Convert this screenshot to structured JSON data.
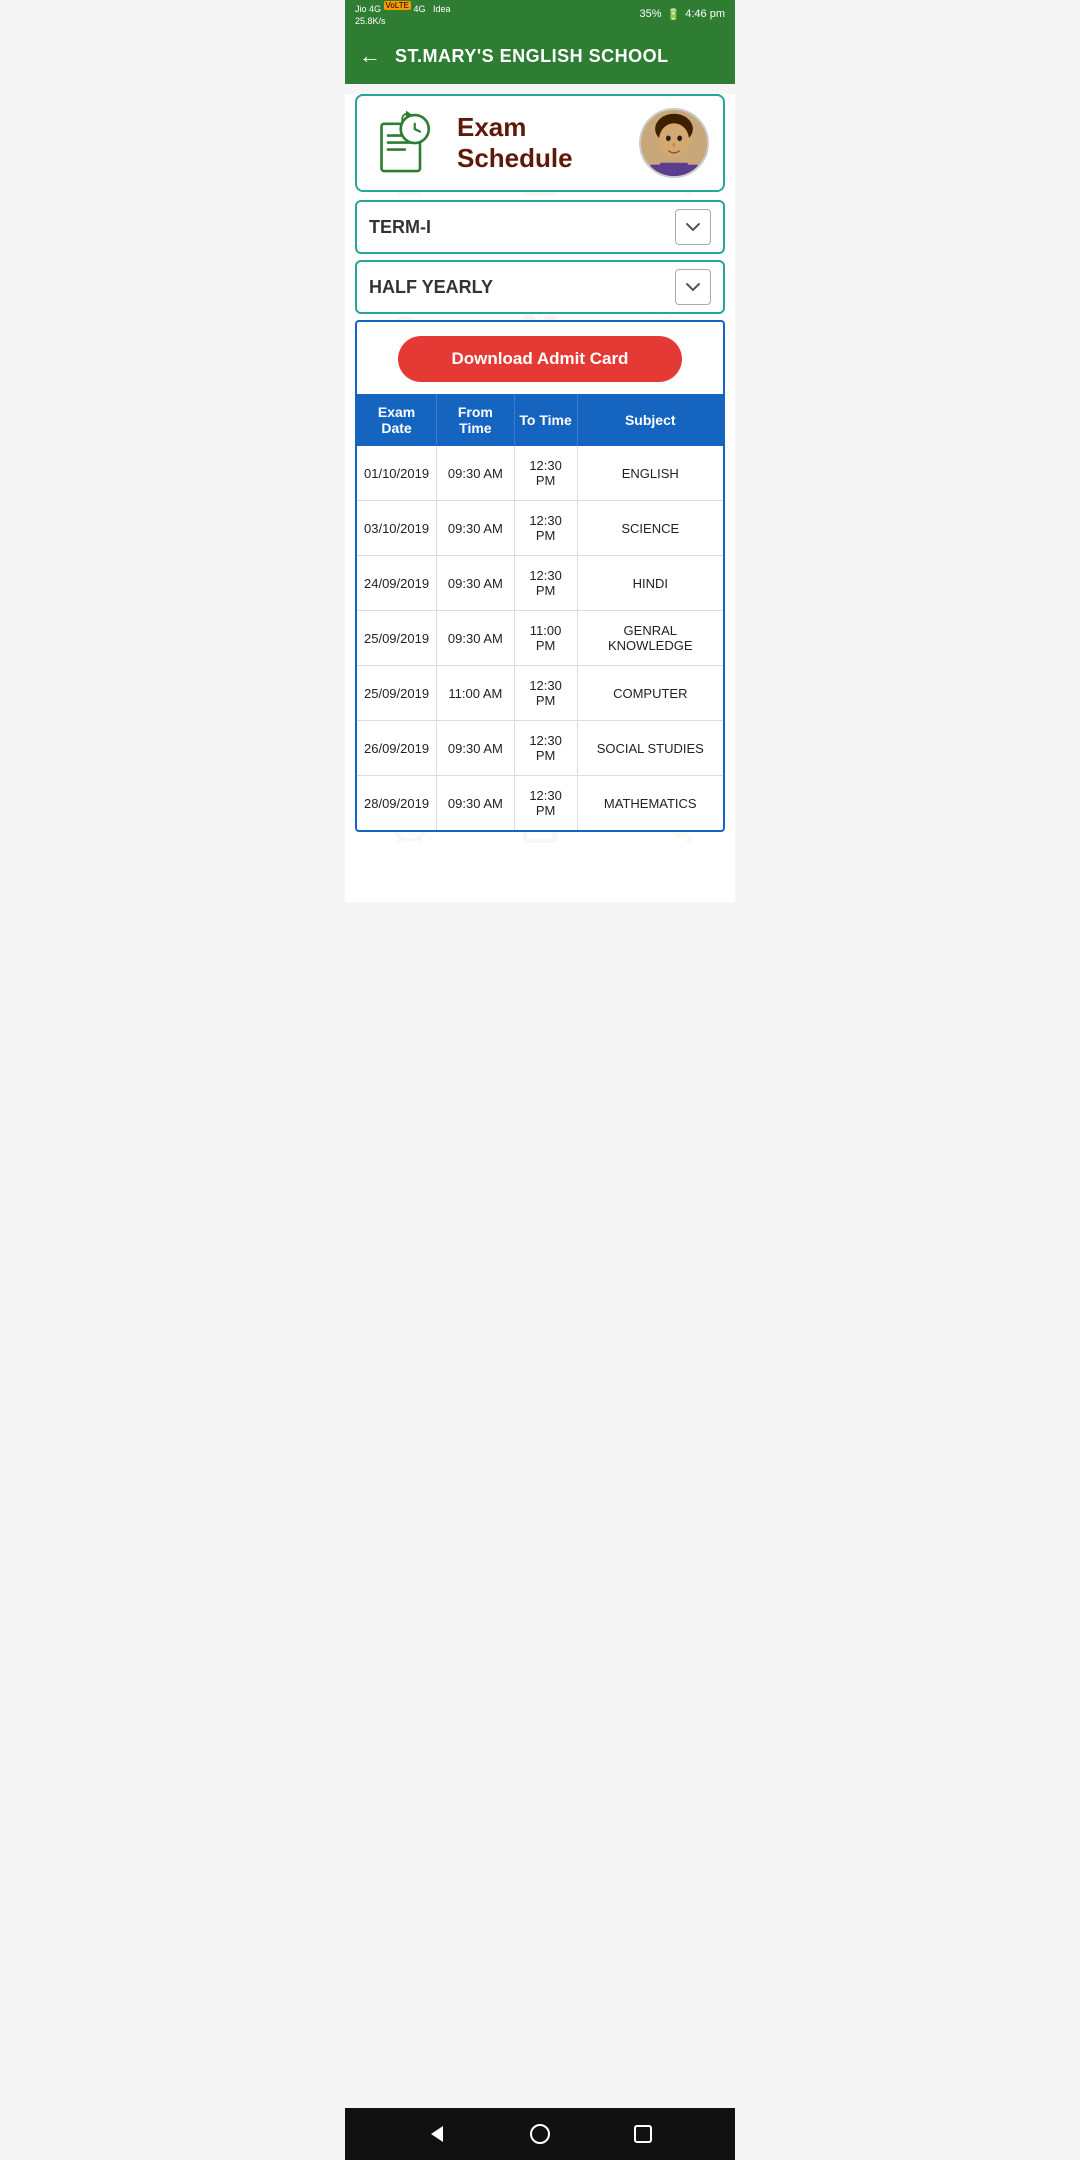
{
  "statusBar": {
    "carrier1": "Jio 4G",
    "carrier2": "Idea",
    "signal": "25.8K/s",
    "battery": "35%",
    "time": "4:46 pm"
  },
  "header": {
    "title": "ST.MARY'S ENGLISH SCHOOL",
    "backLabel": "←"
  },
  "examSchedule": {
    "title": "Exam Schedule",
    "iconAlt": "exam-schedule-icon"
  },
  "dropdowns": {
    "term": "TERM-I",
    "period": "HALF YEARLY"
  },
  "downloadButton": "Download Admit Card",
  "table": {
    "headers": [
      "Exam Date",
      "From Time",
      "To Time",
      "Subject"
    ],
    "rows": [
      {
        "date": "01/10/2019",
        "from": "09:30 AM",
        "to": "12:30 PM",
        "subject": "ENGLISH"
      },
      {
        "date": "03/10/2019",
        "from": "09:30 AM",
        "to": "12:30 PM",
        "subject": "SCIENCE"
      },
      {
        "date": "24/09/2019",
        "from": "09:30 AM",
        "to": "12:30 PM",
        "subject": "HINDI"
      },
      {
        "date": "25/09/2019",
        "from": "09:30 AM",
        "to": "11:00 PM",
        "subject": "GENRAL KNOWLEDGE"
      },
      {
        "date": "25/09/2019",
        "from": "11:00 AM",
        "to": "12:30 PM",
        "subject": "COMPUTER"
      },
      {
        "date": "26/09/2019",
        "from": "09:30 AM",
        "to": "12:30 PM",
        "subject": "SOCIAL STUDIES"
      },
      {
        "date": "28/09/2019",
        "from": "09:30 AM",
        "to": "12:30 PM",
        "subject": "MATHEMATICS"
      }
    ]
  },
  "bottomNav": {
    "back": "◁",
    "home": "○",
    "recents": "□"
  }
}
